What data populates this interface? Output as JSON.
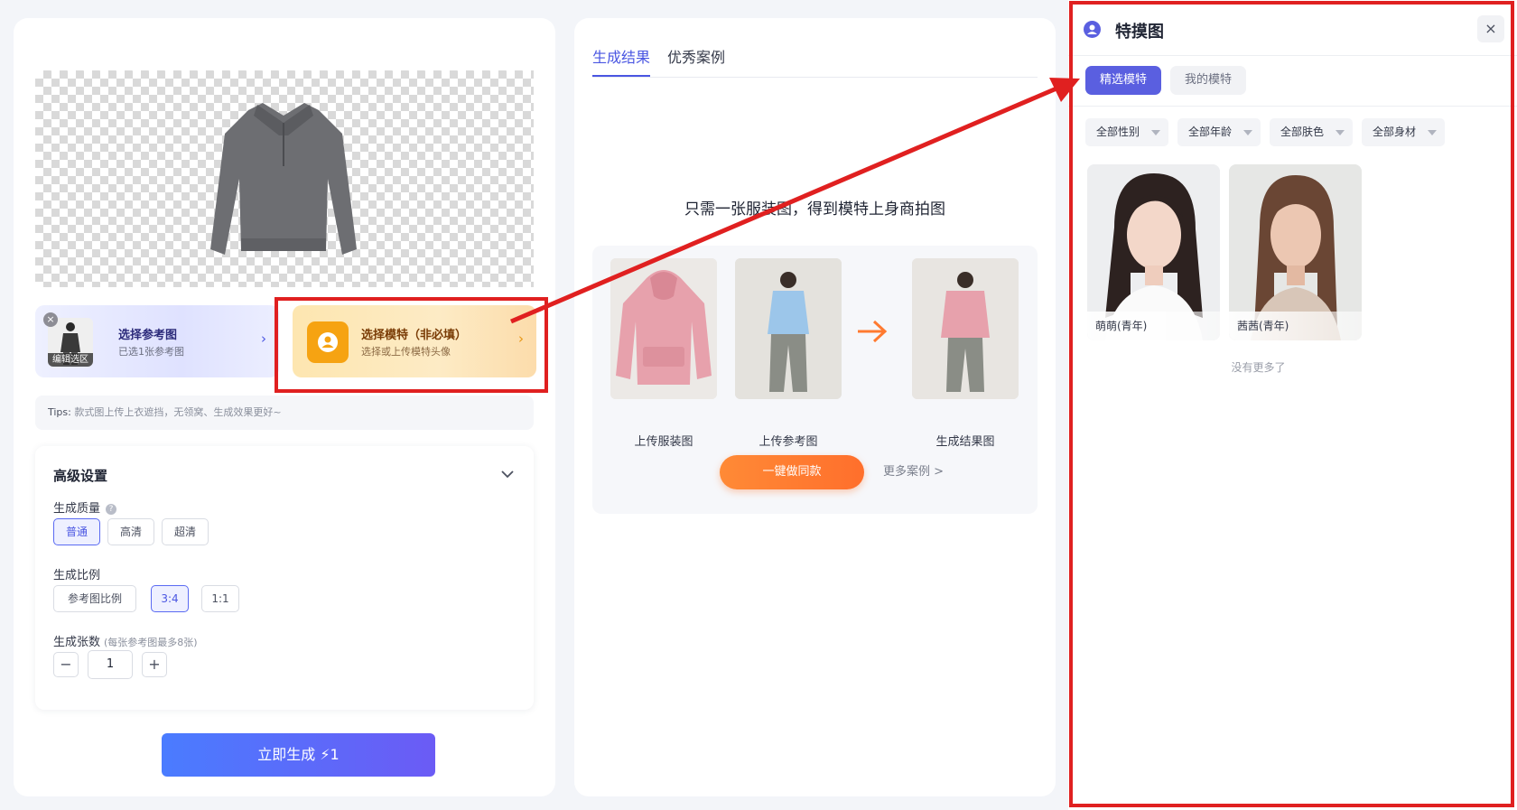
{
  "left": {
    "ref_card": {
      "title": "选择参考图",
      "subtitle": "已选1张参考图",
      "thumb_label": "编辑选区",
      "close_glyph": "×",
      "arrow": "›"
    },
    "model_card": {
      "title": "选择模特（非必填）",
      "subtitle": "选择或上传模特头像",
      "arrow": "›"
    },
    "tips": {
      "label": "Tips:",
      "text": "款式图上传上衣遮挡，无领窝、生成效果更好~"
    },
    "advanced": {
      "title": "高级设置",
      "quality_label": "生成质量",
      "help_glyph": "?",
      "quality_options": [
        "普通",
        "高清",
        "超清"
      ],
      "quality_selected": "普通",
      "ratio_label": "生成比例",
      "ratio_options": [
        "参考图比例",
        "3:4",
        "1:1"
      ],
      "ratio_selected": "3:4",
      "count_label": "生成张数",
      "count_note": "(每张参考图最多8张)",
      "count_value": "1",
      "minus": "−",
      "plus": "+"
    },
    "generate_button": "立即生成 ⚡1"
  },
  "middle": {
    "tabs": [
      "生成结果",
      "优秀案例"
    ],
    "active_tab": "生成结果",
    "headline": "只需一张服装图，得到模特上身商拍图",
    "captions": [
      "上传服装图",
      "上传参考图",
      "生成结果图"
    ],
    "same_button": "一键做同款",
    "more_link": "更多案例 >"
  },
  "drawer": {
    "title": "特摸图",
    "close_glyph": "×",
    "tabs": [
      "精选模特",
      "我的模特"
    ],
    "active_tab": "精选模特",
    "filters": [
      "全部性别",
      "全部年龄",
      "全部肤色",
      "全部身材"
    ],
    "models": [
      {
        "name": "萌萌(青年)"
      },
      {
        "name": "茜茜(青年)"
      }
    ],
    "empty_text": "没有更多了"
  },
  "colors": {
    "accent": "#4a56e2",
    "annotation_red": "#e02020",
    "orange": "#ff7a30"
  }
}
